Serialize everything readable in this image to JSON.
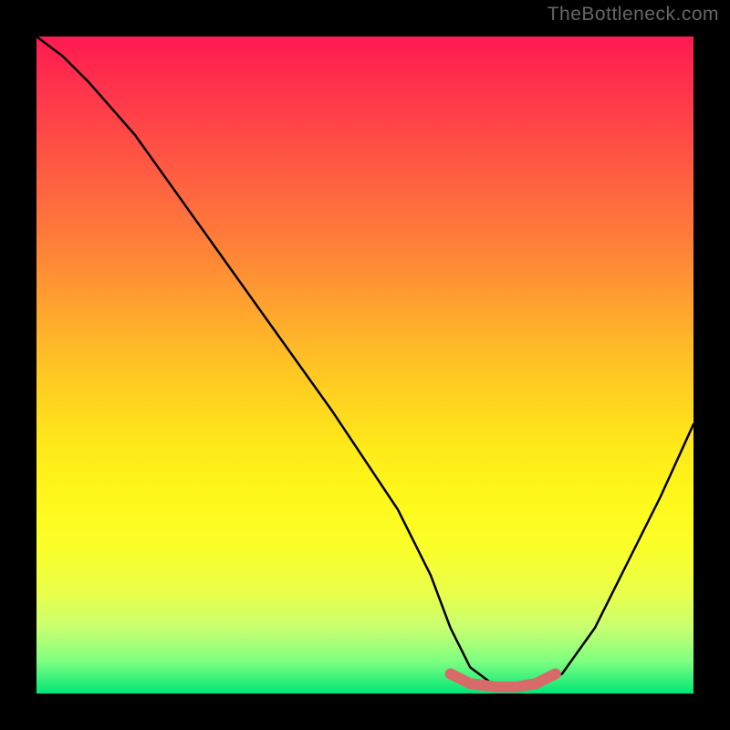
{
  "watermark": "TheBottleneck.com",
  "chart_data": {
    "type": "line",
    "title": "",
    "xlabel": "",
    "ylabel": "",
    "xlim": [
      0,
      100
    ],
    "ylim": [
      0,
      100
    ],
    "series": [
      {
        "name": "bottleneck-curve",
        "x": [
          0,
          4,
          8,
          15,
          25,
          35,
          45,
          55,
          60,
          63,
          66,
          70,
          73,
          76,
          80,
          85,
          90,
          95,
          100
        ],
        "values": [
          100,
          97,
          93,
          85,
          71,
          57,
          43,
          28,
          18,
          10,
          4,
          1,
          1,
          1,
          3,
          10,
          20,
          30,
          41
        ]
      },
      {
        "name": "optimal-highlight",
        "x": [
          63,
          66,
          70,
          73,
          76,
          79
        ],
        "values": [
          3,
          1.5,
          1,
          1,
          1.5,
          3
        ]
      }
    ],
    "gradient_stops": [
      {
        "pos": 0,
        "color": "#ff1a52"
      },
      {
        "pos": 10,
        "color": "#ff3a4a"
      },
      {
        "pos": 20,
        "color": "#ff5a42"
      },
      {
        "pos": 30,
        "color": "#ff7a3a"
      },
      {
        "pos": 38,
        "color": "#ff9732"
      },
      {
        "pos": 46,
        "color": "#ffb529"
      },
      {
        "pos": 54,
        "color": "#ffd021"
      },
      {
        "pos": 62,
        "color": "#ffe81a"
      },
      {
        "pos": 70,
        "color": "#fff81a"
      },
      {
        "pos": 78,
        "color": "#faff2a"
      },
      {
        "pos": 85,
        "color": "#e8ff4d"
      },
      {
        "pos": 90,
        "color": "#c8ff70"
      },
      {
        "pos": 95,
        "color": "#80ff80"
      },
      {
        "pos": 100,
        "color": "#00e676"
      }
    ]
  }
}
